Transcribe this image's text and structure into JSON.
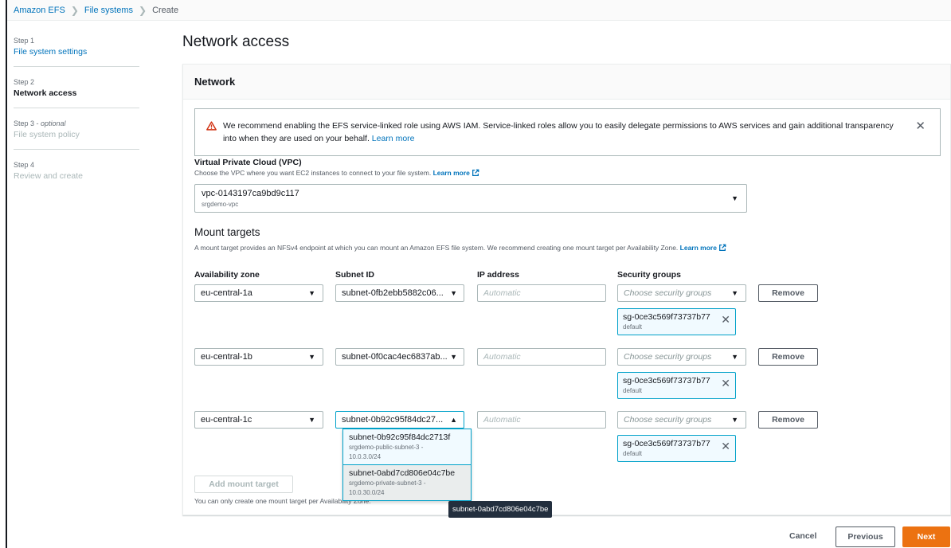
{
  "breadcrumb": {
    "root": "Amazon EFS",
    "section": "File systems",
    "current": "Create"
  },
  "steps": [
    {
      "num": "Step 1",
      "optional": "",
      "title": "File system settings",
      "state": "link"
    },
    {
      "num": "Step 2",
      "optional": "",
      "title": "Network access",
      "state": "active"
    },
    {
      "num": "Step 3 - ",
      "optional": "optional",
      "title": "File system policy",
      "state": "disabled"
    },
    {
      "num": "Step 4",
      "optional": "",
      "title": "Review and create",
      "state": "disabled"
    }
  ],
  "page_title": "Network access",
  "network": {
    "header": "Network",
    "alert": {
      "text": "We recommend enabling the EFS service-linked role using AWS IAM. Service-linked roles allow you to easily delegate permissions to AWS services and gain additional transparency into when they are used on your behalf.",
      "link": "Learn more"
    },
    "vpc": {
      "label": "Virtual Private Cloud (VPC)",
      "description": "Choose the VPC where you want EC2 instances to connect to your file system.",
      "link": "Learn more",
      "value": "vpc-0143197ca9bd9c117",
      "sub": "srgdemo-vpc"
    },
    "mount_targets": {
      "title": "Mount targets",
      "description": "A mount target provides an NFSv4 endpoint at which you can mount an Amazon EFS file system. We recommend creating one mount target per Availability Zone.",
      "link": "Learn more",
      "headers": {
        "az": "Availability zone",
        "subnet": "Subnet ID",
        "ip": "IP address",
        "sg": "Security groups"
      },
      "rows": [
        {
          "az": "eu-central-1a",
          "subnet": "subnet-0fb2ebb5882c06...",
          "ip_placeholder": "Automatic",
          "sg_placeholder": "Choose security groups",
          "remove": "Remove",
          "token": "sg-0ce3c569f73737b77",
          "token_sub": "default"
        },
        {
          "az": "eu-central-1b",
          "subnet": "subnet-0f0cac4ec6837ab...",
          "ip_placeholder": "Automatic",
          "sg_placeholder": "Choose security groups",
          "remove": "Remove",
          "token": "sg-0ce3c569f73737b77",
          "token_sub": "default"
        },
        {
          "az": "eu-central-1c",
          "subnet": "subnet-0b92c95f84dc27...",
          "ip_placeholder": "Automatic",
          "sg_placeholder": "Choose security groups",
          "remove": "Remove",
          "token": "sg-0ce3c569f73737b77",
          "token_sub": "default"
        }
      ],
      "dropdown_options": [
        {
          "id": "subnet-0b92c95f84dc2713f",
          "name": "srgdemo-public-subnet-3 -",
          "cidr": "10.0.3.0/24"
        },
        {
          "id": "subnet-0abd7cd806e04c7be",
          "name": "srgdemo-private-subnet-3 -",
          "cidr": "10.0.30.0/24"
        }
      ],
      "add_button": "Add mount target",
      "add_note": "You can only create one mount target per Availability Zone."
    }
  },
  "tooltip": "subnet-0abd7cd806e04c7be",
  "footer": {
    "cancel": "Cancel",
    "previous": "Previous",
    "next": "Next"
  },
  "colors": {
    "link": "#0073bb",
    "primary": "#ec7211",
    "focus": "#00a1c9",
    "warning": "#d13212"
  }
}
